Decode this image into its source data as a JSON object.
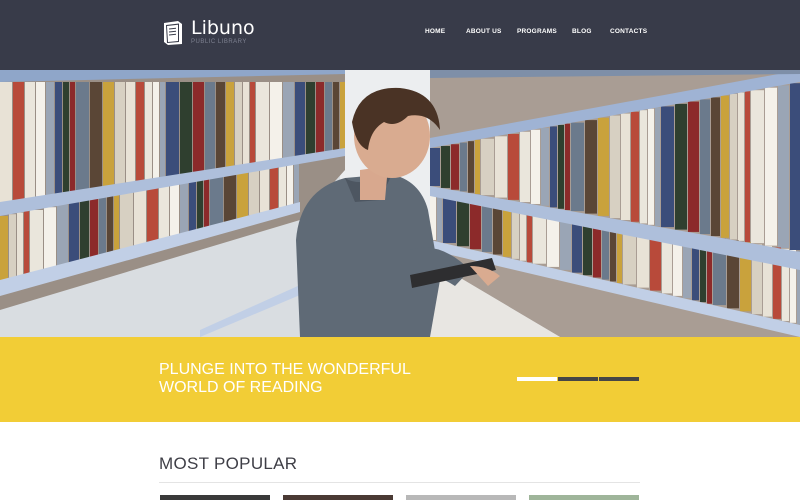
{
  "header": {
    "logo_title": "Libuno",
    "logo_subtitle": "PUBLIC LIBRARY",
    "logo_icon": "book-icon",
    "nav": [
      "HOME",
      "ABOUT US",
      "PROGRAMS",
      "BLOG",
      "CONTACTS"
    ]
  },
  "hero": {
    "image": "man-reading-in-library-photo"
  },
  "banner": {
    "line1": "PLUNGE INTO THE WONDERFUL",
    "line2": "WORLD OF READING",
    "slides_total": 3,
    "active_slide": 1
  },
  "popular": {
    "title": "MOST POPULAR",
    "thumbnails": 4
  },
  "colors": {
    "header_bg": "#383b49",
    "accent": "#f2cd36",
    "text_dark": "#3e3e46"
  }
}
